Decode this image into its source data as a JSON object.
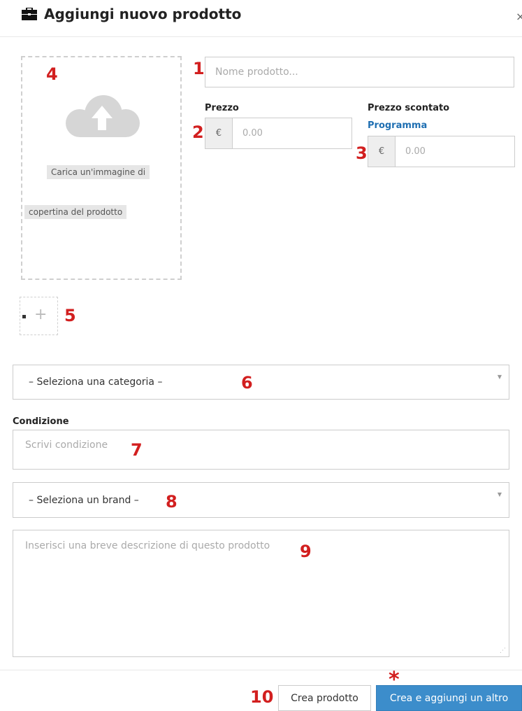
{
  "modal": {
    "title": "Aggiungi nuovo prodotto",
    "close_glyph": "×"
  },
  "icons": {
    "title_icon": "briefcase-icon",
    "upload_icon": "cloud-upload-icon",
    "add_icon": "plus-icon",
    "caret_icon": "caret-down-icon"
  },
  "image_upload": {
    "text_line1": "Carica un'immagine di",
    "text_line2": "copertina del prodotto"
  },
  "add_image_glyph": "+",
  "product_name": {
    "placeholder": "Nome prodotto..."
  },
  "price": {
    "label": "Prezzo",
    "currency": "€",
    "placeholder": "0.00"
  },
  "discount_price": {
    "label": "Prezzo scontato",
    "schedule_link": "Programma",
    "currency": "€",
    "placeholder": "0.00"
  },
  "category_select": {
    "selected": "– Seleziona una categoria –"
  },
  "condition": {
    "label": "Condizione",
    "placeholder": "Scrivi condizione"
  },
  "brand_select": {
    "selected": "– Seleziona un brand –"
  },
  "description": {
    "placeholder": "Inserisci una breve descrizione di questo prodotto"
  },
  "footer": {
    "create_label": "Crea prodotto",
    "create_another_label": "Crea e aggiungi un altro"
  },
  "annotations": {
    "n1": "1",
    "n2": "2",
    "n3": "3",
    "n4": "4",
    "n5": "5",
    "n6": "6",
    "n7": "7",
    "n8": "8",
    "n9": "9",
    "n10": "10",
    "star": "*"
  },
  "colors": {
    "primary": "#3c8dcb",
    "link": "#1f6fb2",
    "annotation": "#d21f1f"
  }
}
